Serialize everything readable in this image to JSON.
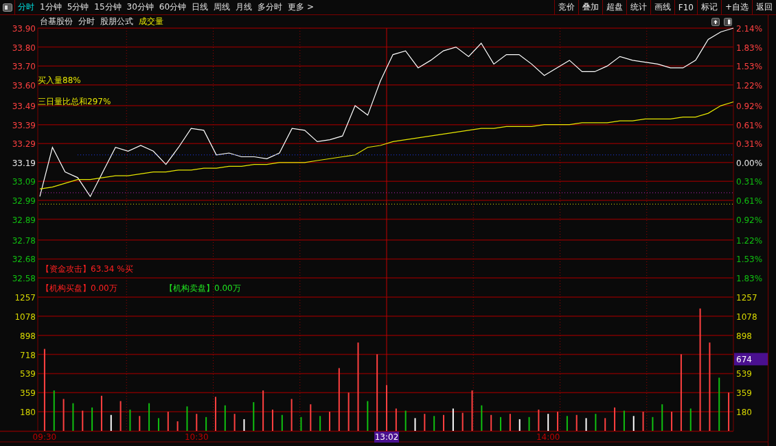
{
  "toolbar": {
    "tabs": [
      {
        "label": "分时",
        "selected": true
      },
      {
        "label": "1分钟",
        "selected": false
      },
      {
        "label": "5分钟",
        "selected": false
      },
      {
        "label": "15分钟",
        "selected": false
      },
      {
        "label": "30分钟",
        "selected": false
      },
      {
        "label": "60分钟",
        "selected": false
      },
      {
        "label": "日线",
        "selected": false
      },
      {
        "label": "周线",
        "selected": false
      },
      {
        "label": "月线",
        "selected": false
      },
      {
        "label": "多分时",
        "selected": false
      },
      {
        "label": "更多 >",
        "selected": false
      }
    ],
    "buttons": [
      "竞价",
      "叠加",
      "超盘",
      "统计",
      "画线",
      "F10",
      "标记",
      "+自选",
      "返回"
    ]
  },
  "header": {
    "stock_name": "台基股份",
    "view": "分时",
    "formula": "股朋公式",
    "indicator": "成交量"
  },
  "price_chart": {
    "overlays": [
      {
        "text": "买入量88%",
        "color": "#e8e800"
      },
      {
        "text": "三日量比总和297%",
        "color": "#e8e800"
      }
    ],
    "indicator_rows": [
      {
        "items": [
          {
            "text": "【资金攻击】63.34 %买",
            "color": "#ff2020"
          }
        ]
      },
      {
        "items": [
          {
            "text": "【机构买盘】0.00万",
            "color": "#ff2020"
          },
          {
            "text": "【机构卖盘】0.00万",
            "color": "#20e020"
          }
        ]
      }
    ],
    "percent_axis": [
      {
        "label": "2.14%",
        "kind": "up"
      },
      {
        "label": "1.83%",
        "kind": "up"
      },
      {
        "label": "1.53%",
        "kind": "up"
      },
      {
        "label": "1.22%",
        "kind": "up"
      },
      {
        "label": "0.92%",
        "kind": "up"
      },
      {
        "label": "0.61%",
        "kind": "up"
      },
      {
        "label": "0.31%",
        "kind": "up"
      },
      {
        "label": "0.00%",
        "kind": "flat"
      },
      {
        "label": "0.31%",
        "kind": "down"
      },
      {
        "label": "0.61%",
        "kind": "down"
      },
      {
        "label": "0.92%",
        "kind": "down"
      },
      {
        "label": "1.22%",
        "kind": "down"
      },
      {
        "label": "1.53%",
        "kind": "down"
      },
      {
        "label": "1.83%",
        "kind": "down"
      }
    ],
    "chart_data": {
      "type": "line",
      "grid": true,
      "ylim": [
        32.58,
        33.9
      ],
      "yticks": [
        {
          "value": 33.9,
          "label": "33.90"
        },
        {
          "value": 33.8,
          "label": "33.80"
        },
        {
          "value": 33.7,
          "label": "33.70"
        },
        {
          "value": 33.6,
          "label": "33.60"
        },
        {
          "value": 33.49,
          "label": "33.49"
        },
        {
          "value": 33.39,
          "label": "33.39"
        },
        {
          "value": 33.29,
          "label": "33.29"
        },
        {
          "value": 33.19,
          "label": "33.19"
        },
        {
          "value": 33.09,
          "label": "33.09"
        },
        {
          "value": 32.99,
          "label": "32.99"
        },
        {
          "value": 32.89,
          "label": "32.89"
        },
        {
          "value": 32.78,
          "label": "32.78"
        },
        {
          "value": 32.68,
          "label": "32.68"
        },
        {
          "value": 32.58,
          "label": "32.58"
        }
      ],
      "categories": [
        null,
        null,
        null,
        null,
        null,
        null,
        null,
        null,
        null,
        null,
        null,
        null,
        null,
        null,
        null,
        null,
        null,
        null,
        null,
        null,
        null,
        null,
        null,
        null,
        null,
        null,
        null,
        null,
        null,
        null,
        null,
        null,
        null,
        null,
        null,
        null,
        null,
        null,
        null,
        null,
        null,
        null,
        null,
        null,
        null,
        null,
        null,
        null,
        null,
        null,
        null,
        null,
        null,
        null,
        null,
        null
      ],
      "series": [
        {
          "color": "#ffffff",
          "values": [
            33.01,
            33.27,
            33.14,
            33.11,
            33.01,
            33.14,
            33.27,
            33.25,
            33.28,
            33.25,
            33.18,
            33.27,
            33.37,
            33.36,
            33.23,
            33.24,
            33.22,
            33.22,
            33.21,
            33.24,
            33.37,
            33.36,
            33.3,
            33.31,
            33.33,
            33.49,
            33.44,
            33.62,
            33.76,
            33.78,
            33.69,
            33.73,
            33.78,
            33.8,
            33.75,
            33.82,
            33.71,
            33.76,
            33.76,
            33.71,
            33.65,
            33.69,
            33.73,
            33.67,
            33.67,
            33.7,
            33.75,
            33.73,
            33.72,
            33.71,
            33.69,
            33.69,
            33.73,
            33.84,
            33.88,
            33.9
          ]
        },
        {
          "color": "#e8e800",
          "values": [
            33.05,
            33.06,
            33.08,
            33.1,
            33.1,
            33.11,
            33.12,
            33.12,
            33.13,
            33.14,
            33.14,
            33.15,
            33.15,
            33.16,
            33.16,
            33.17,
            33.17,
            33.18,
            33.18,
            33.19,
            33.19,
            33.19,
            33.2,
            33.21,
            33.22,
            33.23,
            33.27,
            33.28,
            33.3,
            33.31,
            33.32,
            33.33,
            33.34,
            33.35,
            33.36,
            33.37,
            33.37,
            33.38,
            33.38,
            33.38,
            33.39,
            33.39,
            33.39,
            33.4,
            33.4,
            33.4,
            33.41,
            33.41,
            33.42,
            33.42,
            33.42,
            33.43,
            33.43,
            33.45,
            33.49,
            33.51
          ]
        },
        {
          "color": "#2040ff",
          "line_style": "dotted",
          "values": [
            null,
            null,
            null,
            33.23,
            33.23,
            33.23,
            33.23,
            33.23,
            33.23,
            33.23,
            33.23,
            33.23,
            33.23,
            33.23,
            33.23,
            33.23,
            33.23,
            33.23,
            33.23,
            33.23,
            33.23,
            33.23,
            33.23,
            33.23,
            33.23,
            33.23,
            33.23,
            33.23,
            33.23,
            33.23,
            33.23,
            33.23,
            33.23,
            33.23,
            33.23,
            33.23,
            33.23,
            33.23,
            33.23,
            33.23,
            33.23,
            33.23,
            33.23,
            33.23,
            33.23,
            33.23,
            33.23,
            33.23,
            33.23,
            33.23,
            33.23,
            33.23,
            33.23,
            33.23,
            33.23,
            33.23
          ]
        },
        {
          "color": "#c020c0",
          "line_style": "dotted",
          "values": [
            33.03,
            33.03,
            33.03,
            33.03,
            33.03,
            33.03,
            33.03,
            33.03,
            33.03,
            33.03,
            33.03,
            33.03,
            33.03,
            33.03,
            33.03,
            33.03,
            33.03,
            33.03,
            33.03,
            33.03,
            33.03,
            33.03,
            33.03,
            33.03,
            33.03,
            33.03,
            33.03,
            33.03,
            33.03,
            33.03,
            33.03,
            33.03,
            33.03,
            33.03,
            33.03,
            33.03,
            33.03,
            33.03,
            33.03,
            33.03,
            33.03,
            33.03,
            33.03,
            33.03,
            33.03,
            33.03,
            33.03,
            33.03,
            33.03,
            33.03,
            33.03,
            33.03,
            33.03,
            33.03,
            33.03,
            33.03
          ]
        },
        {
          "color": "#e8e800",
          "line_style": "dotted",
          "values": [
            32.97,
            32.97,
            32.97,
            32.97,
            32.97,
            32.97,
            32.97,
            32.97,
            32.97,
            32.97,
            32.97,
            32.97,
            32.97,
            32.97,
            32.97,
            32.97,
            32.97,
            32.97,
            32.97,
            32.97,
            32.97,
            32.97,
            32.97,
            32.97,
            32.97,
            32.97,
            32.97,
            32.97,
            32.97,
            32.97,
            32.97,
            32.97,
            32.97,
            32.97,
            32.97,
            32.97,
            32.97,
            32.97,
            32.97,
            32.97,
            32.97,
            32.97,
            32.97,
            32.97,
            32.97,
            32.97,
            32.97,
            32.97,
            32.97,
            32.97,
            32.97,
            32.97,
            32.97,
            32.97,
            32.97,
            32.97
          ]
        }
      ]
    }
  },
  "volume_chart": {
    "cursor_label": "13:02",
    "readout": "674",
    "chart_data": {
      "type": "bar",
      "grid": true,
      "ylim": [
        0,
        1257
      ],
      "yticks": [
        {
          "value": 1257,
          "label": "1257"
        },
        {
          "value": 1078,
          "label": "1078"
        },
        {
          "value": 898,
          "label": "898"
        },
        {
          "value": 718,
          "label": "718"
        },
        {
          "value": 539,
          "label": "539"
        },
        {
          "value": 359,
          "label": "359"
        },
        {
          "value": 180,
          "label": "180"
        }
      ],
      "categories": [
        "09:30",
        null,
        null,
        null,
        null,
        null,
        null,
        null,
        null,
        null,
        null,
        null,
        null,
        null,
        null,
        null,
        "10:30",
        null,
        null,
        null,
        null,
        null,
        null,
        null,
        null,
        null,
        null,
        null,
        null,
        null,
        null,
        null,
        null,
        null,
        null,
        null,
        null,
        null,
        null,
        null,
        null,
        null,
        null,
        null,
        null,
        null,
        null,
        null,
        null,
        null,
        null,
        null,
        null,
        "14:00",
        null,
        null,
        null,
        null,
        null,
        null,
        null,
        null,
        null,
        null,
        null,
        null,
        null,
        null,
        null,
        null,
        null,
        null,
        null
      ],
      "series": [
        {
          "color": "#ff4040",
          "values": [
            770,
            null,
            300,
            null,
            190,
            null,
            330,
            null,
            280,
            null,
            140,
            null,
            null,
            180,
            90,
            null,
            160,
            null,
            320,
            null,
            160,
            null,
            null,
            380,
            200,
            null,
            300,
            null,
            250,
            null,
            180,
            590,
            360,
            830,
            null,
            720,
            430,
            210,
            null,
            null,
            160,
            null,
            150,
            null,
            170,
            380,
            null,
            150,
            null,
            160,
            null,
            null,
            200,
            null,
            180,
            null,
            150,
            null,
            null,
            120,
            220,
            null,
            null,
            180,
            null,
            null,
            180,
            720,
            null,
            1150,
            830,
            null,
            360
          ]
        },
        {
          "color": "#10c010",
          "values": [
            null,
            380,
            null,
            260,
            null,
            220,
            null,
            null,
            null,
            200,
            null,
            260,
            120,
            null,
            null,
            230,
            null,
            130,
            null,
            240,
            null,
            null,
            270,
            null,
            null,
            150,
            null,
            130,
            null,
            140,
            null,
            null,
            null,
            null,
            280,
            null,
            null,
            null,
            190,
            null,
            null,
            140,
            null,
            null,
            null,
            null,
            240,
            null,
            130,
            null,
            null,
            130,
            null,
            null,
            null,
            140,
            null,
            null,
            160,
            null,
            null,
            190,
            null,
            null,
            130,
            250,
            null,
            null,
            210,
            null,
            null,
            500,
            null
          ]
        },
        {
          "color": "#ffffff",
          "values": [
            null,
            null,
            null,
            null,
            null,
            null,
            null,
            150,
            null,
            null,
            null,
            null,
            null,
            null,
            null,
            null,
            null,
            null,
            null,
            null,
            null,
            110,
            null,
            null,
            null,
            null,
            null,
            null,
            null,
            null,
            null,
            null,
            null,
            null,
            null,
            null,
            null,
            null,
            null,
            120,
            null,
            null,
            null,
            210,
            null,
            null,
            null,
            null,
            null,
            null,
            110,
            null,
            null,
            160,
            null,
            null,
            null,
            120,
            null,
            null,
            null,
            null,
            140,
            null,
            null,
            null,
            null,
            null,
            null,
            null,
            null,
            null,
            null
          ]
        }
      ]
    }
  }
}
